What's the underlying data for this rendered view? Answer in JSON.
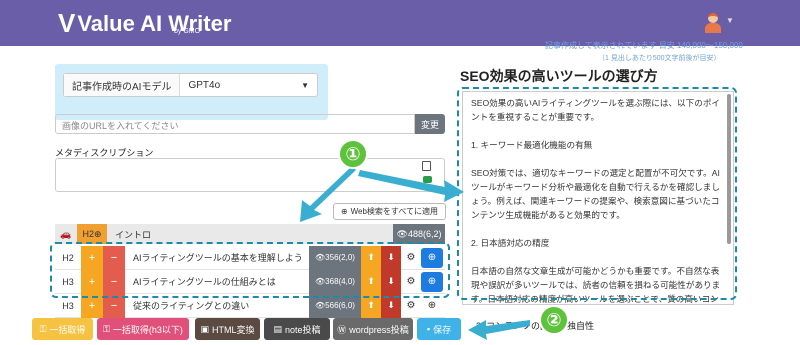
{
  "header": {
    "logo_mark": "V",
    "logo_text": "Value AI Writer",
    "logo_sub": "by GMO",
    "notice_line1": "記事作成して表示されています 目安 140,000～150,000",
    "notice_line2": "（1 見出しあたり500文字前後が目安）"
  },
  "settings": {
    "model_label": "記事作成時のAIモデル",
    "model_value": "GPT4o",
    "image_url_placeholder": "画像のURLを入れてください",
    "change_label": "変更",
    "meta_label": "メタディスクリプション",
    "web_search_all_label": "Web検索をすべてに適用"
  },
  "intro": {
    "icon": "car-icon",
    "level": "H2",
    "text": "イントロ",
    "count": "488(6,2)"
  },
  "outline": [
    {
      "level": "H2",
      "text": "AIライティングツールの基本を理解しよう",
      "count": "356(2,0)",
      "web": true
    },
    {
      "level": "H3",
      "text": "AIライティングツールの仕組みとは",
      "count": "368(4,0)",
      "web": true
    },
    {
      "level": "H3",
      "text": "従来のライティングとの違い",
      "count": "566(6,0)",
      "web": false
    }
  ],
  "footer_buttons": [
    {
      "label": "一括取得",
      "color": "#f5c242"
    },
    {
      "label": "一括取得(h3以下)",
      "color": "#e0507a"
    },
    {
      "label": "HTML変換",
      "color": "#5a4a42"
    },
    {
      "label": "note投稿",
      "color": "#4a4a4a"
    },
    {
      "label": "wordpress投稿",
      "color": "#6a6a6a"
    },
    {
      "label": "保存",
      "color": "#3fb2e8"
    }
  ],
  "article": {
    "title": "SEO効果の高いツールの選び方",
    "paragraphs": [
      "SEO効果の高いAIライティングツールを選ぶ際には、以下のポイントを重視することが重要です。",
      "1. キーワード最適化機能の有無",
      "SEO対策では、適切なキーワードの選定と配置が不可欠です。AIツールがキーワード分析や最適化を自動で行えるかを確認しましょう。例えば、関連キーワードの提案や、検索意図に基づいたコンテンツ生成機能があると効果的です。",
      "2. 日本語対応の精度",
      "日本語の自然な文章生成が可能かどうかも重要です。不自然な表現や誤訳が多いツールでは、読者の信頼を損ねる可能性があります。日本語対応の精度が高いツールを選ぶことで、質の高いコンテンツ作成が期待できます。"
    ],
    "below_text": "3. コンテンツの品質と独自性"
  },
  "callouts": {
    "one": "①",
    "two": "②"
  },
  "colors": {
    "header": "#6a5ea8",
    "dash": "#1d8aa8",
    "callout": "#5fc23c",
    "arrow": "#3aaed0"
  }
}
